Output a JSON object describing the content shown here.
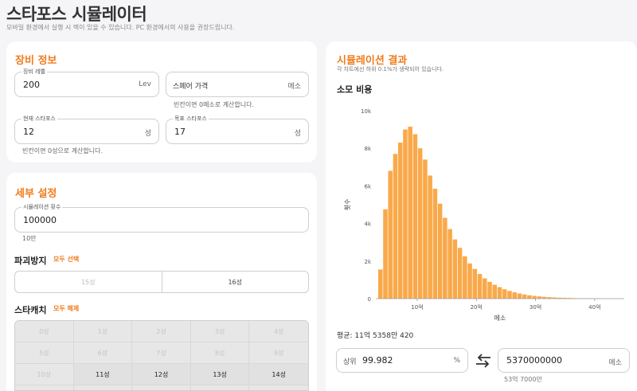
{
  "header": {
    "title": "스타포스 시뮬레이터",
    "subtitle": "모바일 환경에서 실행 시 렉이 있을 수 있습니다. PC 환경에서의 사용을 권장드립니다."
  },
  "equipment": {
    "title": "장비 정보",
    "level": {
      "label": "장비 레벨",
      "value": "200",
      "suffix": "Lev"
    },
    "spare_price": {
      "placeholder": "스페어 가격",
      "suffix": "메소",
      "hint": "빈칸이면 0메소로 계산합니다."
    },
    "current_star": {
      "label": "현재 스타포스",
      "value": "12",
      "suffix": "성",
      "hint": "빈칸이면 0성으로 계산합니다."
    },
    "target_star": {
      "label": "목표 스타포스",
      "value": "17",
      "suffix": "성"
    }
  },
  "details": {
    "title": "세부 설정",
    "sim_count": {
      "label": "시뮬레이션 횟수",
      "value": "100000",
      "hint": "10만"
    },
    "destroy_guard": {
      "label": "파괴방지",
      "action": "모두 선택",
      "options": [
        {
          "label": "15성",
          "selected": false
        },
        {
          "label": "16성",
          "selected": true
        }
      ]
    },
    "star_catch": {
      "label": "스타캐치",
      "action": "모두 해제",
      "cells": [
        {
          "label": "0성",
          "enabled": false
        },
        {
          "label": "1성",
          "enabled": false
        },
        {
          "label": "2성",
          "enabled": false
        },
        {
          "label": "3성",
          "enabled": false
        },
        {
          "label": "4성",
          "enabled": false
        },
        {
          "label": "5성",
          "enabled": false
        },
        {
          "label": "6성",
          "enabled": false
        },
        {
          "label": "7성",
          "enabled": false
        },
        {
          "label": "8성",
          "enabled": false
        },
        {
          "label": "9성",
          "enabled": false
        },
        {
          "label": "10성",
          "enabled": false
        },
        {
          "label": "11성",
          "enabled": true
        },
        {
          "label": "12성",
          "enabled": true
        },
        {
          "label": "13성",
          "enabled": true
        },
        {
          "label": "14성",
          "enabled": true
        }
      ]
    }
  },
  "result": {
    "title": "시뮬레이션 결과",
    "subtitle": "각 차트에선 하위 0.1%가 생략되어 있습니다.",
    "cost_title": "소모 비용",
    "average": "평균: 11억 5358만 420",
    "percentile": {
      "prefix": "상위",
      "value": "99.982",
      "suffix": "%"
    },
    "meso": {
      "value": "5370000000",
      "suffix": "메소",
      "hint": "53억 7000만"
    }
  },
  "colors": {
    "accent": "#f07c1c",
    "bar": "#f9a94a"
  },
  "chart_data": {
    "type": "bar",
    "xlabel": "메소",
    "ylabel": "횟수",
    "x_ticks": [
      {
        "label": "10억",
        "value": 10
      },
      {
        "label": "20억",
        "value": 20
      },
      {
        "label": "30억",
        "value": 30
      },
      {
        "label": "40억",
        "value": 40
      }
    ],
    "y_ticks": [
      {
        "label": "0",
        "value": 0
      },
      {
        "label": "2k",
        "value": 2000
      },
      {
        "label": "4k",
        "value": 4000
      },
      {
        "label": "6k",
        "value": 6000
      },
      {
        "label": "8k",
        "value": 8000
      },
      {
        "label": "10k",
        "value": 10000
      }
    ],
    "ylim": [
      0,
      10000
    ],
    "xlim": [
      3,
      45
    ],
    "bin_start": 3.4,
    "bin_width": 0.84,
    "values": [
      1550,
      4750,
      6800,
      7700,
      8300,
      9000,
      9150,
      8750,
      8000,
      7400,
      6550,
      5850,
      5050,
      4300,
      3700,
      3150,
      2700,
      2250,
      1870,
      1580,
      1310,
      1080,
      890,
      740,
      610,
      500,
      410,
      335,
      275,
      220,
      180,
      145,
      120,
      98,
      80,
      65,
      52,
      43,
      35,
      28,
      22,
      18,
      14,
      11,
      9
    ]
  }
}
